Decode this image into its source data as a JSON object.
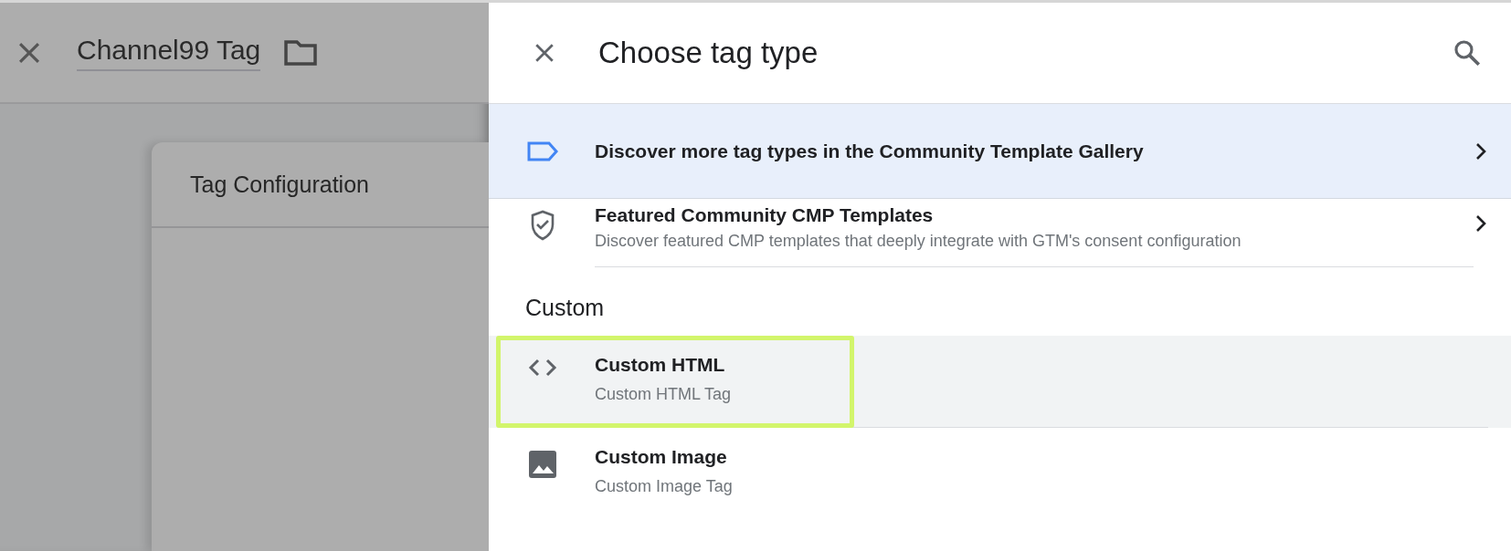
{
  "background": {
    "title": "Channel99 Tag",
    "card_title": "Tag Configuration"
  },
  "panel": {
    "title": "Choose tag type",
    "banner": {
      "text": "Discover more tag types in the Community Template Gallery"
    },
    "featured": {
      "title": "Featured Community CMP Templates",
      "description": "Discover featured CMP templates that deeply integrate with GTM's consent configuration"
    },
    "section": "Custom",
    "items": [
      {
        "kind": "code",
        "title": "Custom HTML",
        "subtitle": "Custom HTML Tag",
        "highlighted": true
      },
      {
        "kind": "image",
        "title": "Custom Image",
        "subtitle": "Custom Image Tag",
        "highlighted": false
      }
    ]
  }
}
